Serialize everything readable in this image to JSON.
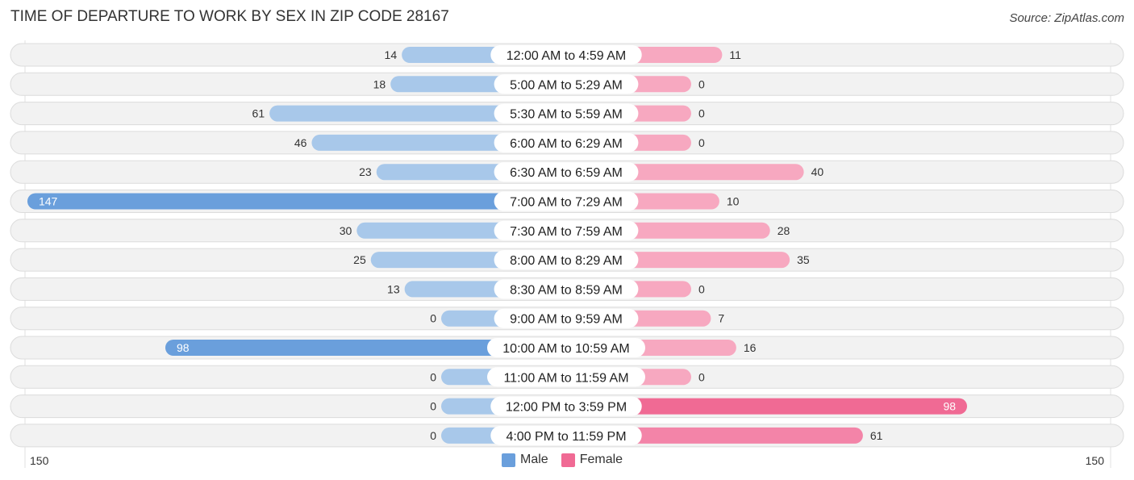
{
  "header": {
    "title": "TIME OF DEPARTURE TO WORK BY SEX IN ZIP CODE 28167",
    "source": "Source: ZipAtlas.com"
  },
  "colors": {
    "male_strong": "#6a9fdc",
    "male_light": "#a8c8ea",
    "female_strong": "#f06a94",
    "female_light": "#f7a8c0",
    "row_bg": "#f2f2f2"
  },
  "chart_data": {
    "type": "bar",
    "orientation": "horizontal-diverging",
    "title": "TIME OF DEPARTURE TO WORK BY SEX IN ZIP CODE 28167",
    "categories": [
      "12:00 AM to 4:59 AM",
      "5:00 AM to 5:29 AM",
      "5:30 AM to 5:59 AM",
      "6:00 AM to 6:29 AM",
      "6:30 AM to 6:59 AM",
      "7:00 AM to 7:29 AM",
      "7:30 AM to 7:59 AM",
      "8:00 AM to 8:29 AM",
      "8:30 AM to 8:59 AM",
      "9:00 AM to 9:59 AM",
      "10:00 AM to 10:59 AM",
      "11:00 AM to 11:59 AM",
      "12:00 PM to 3:59 PM",
      "4:00 PM to 11:59 PM"
    ],
    "series": [
      {
        "name": "Male",
        "side": "left",
        "values": [
          14,
          18,
          61,
          46,
          23,
          147,
          30,
          25,
          13,
          0,
          98,
          0,
          0,
          0
        ]
      },
      {
        "name": "Female",
        "side": "right",
        "values": [
          11,
          0,
          0,
          0,
          40,
          10,
          28,
          35,
          0,
          7,
          16,
          0,
          98,
          61
        ]
      }
    ],
    "axis": {
      "left_label": "150",
      "right_label": "150",
      "range": [
        0,
        150
      ]
    },
    "legend": {
      "position": "bottom-center",
      "entries": [
        "Male",
        "Female"
      ]
    },
    "grid": false
  }
}
